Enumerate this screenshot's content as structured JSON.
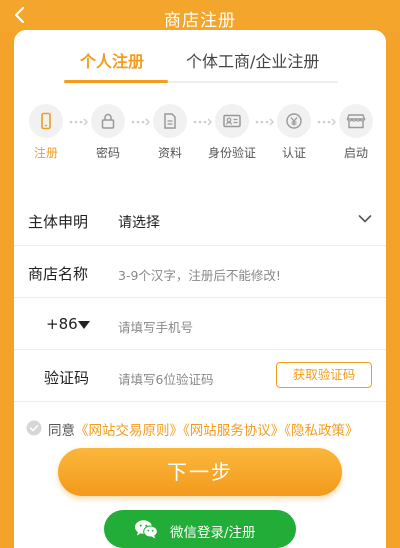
{
  "header": {
    "title": "商店注册"
  },
  "tabs": [
    {
      "label": "个人注册",
      "active": true
    },
    {
      "label": "个体工商/企业注册",
      "active": false
    }
  ],
  "steps": [
    {
      "label": "注册",
      "icon": "phone-icon",
      "active": true
    },
    {
      "label": "密码",
      "icon": "lock-icon",
      "active": false
    },
    {
      "label": "资料",
      "icon": "document-icon",
      "active": false
    },
    {
      "label": "身份验证",
      "icon": "id-card-icon",
      "active": false
    },
    {
      "label": "认证",
      "icon": "yen-icon",
      "active": false
    },
    {
      "label": "启动",
      "icon": "store-icon",
      "active": false
    }
  ],
  "form": {
    "subject_label": "主体申明",
    "subject_value": "请选择",
    "shop_name_label": "商店名称",
    "shop_name_placeholder": "3-9个汉字，注册后不能修改!",
    "phone_prefix": "+86",
    "phone_placeholder": "请填写手机号",
    "code_label": "验证码",
    "code_placeholder": "请填写6位验证码",
    "get_code_label": "获取验证码"
  },
  "agreement": {
    "prefix": "同意",
    "link1": "《网站交易原则》",
    "link2": "《网站服务协议》",
    "link3": "《隐私政策》"
  },
  "buttons": {
    "next_label": "下一步",
    "wechat_label": "微信登录/注册"
  },
  "colors": {
    "accent": "#f39c1d",
    "header": "#f4a52b",
    "wechat": "#22ac38"
  }
}
